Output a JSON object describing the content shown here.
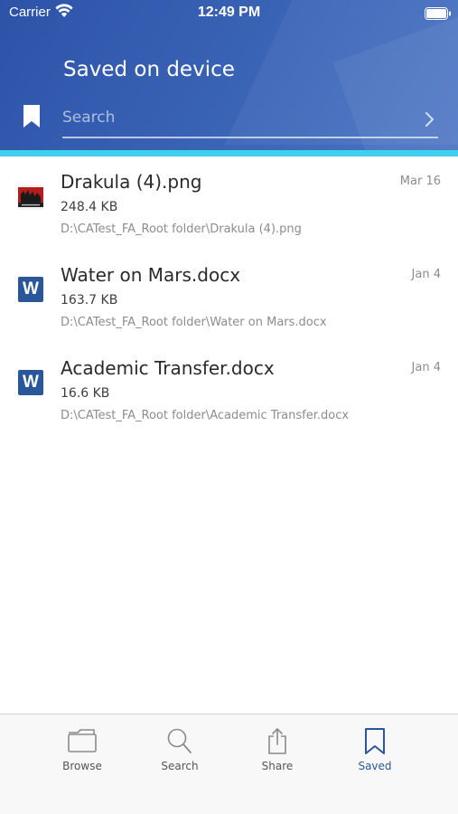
{
  "status_bar": {
    "carrier": "Carrier",
    "time": "12:49 PM"
  },
  "header": {
    "title": "Saved on device",
    "search_placeholder": "Search"
  },
  "files": [
    {
      "name": "Drakula (4).png",
      "size": "248.4 KB",
      "path": "D:\\CATest_FA_Root folder\\Drakula (4).png",
      "date": "Mar 16",
      "icon": "image-thumbnail-icon"
    },
    {
      "name": "Water on Mars.docx",
      "size": "163.7 KB",
      "path": "D:\\CATest_FA_Root folder\\Water on Mars.docx",
      "date": "Jan 4",
      "icon": "word-doc-icon",
      "icon_letter": "W"
    },
    {
      "name": "Academic Transfer.docx",
      "size": "16.6 KB",
      "path": "D:\\CATest_FA_Root folder\\Academic Transfer.docx",
      "date": "Jan 4",
      "icon": "word-doc-icon",
      "icon_letter": "W"
    }
  ],
  "tabs": [
    {
      "label": "Browse",
      "icon": "folder-icon",
      "active": false
    },
    {
      "label": "Search",
      "icon": "magnifier-icon",
      "active": false
    },
    {
      "label": "Share",
      "icon": "share-icon",
      "active": false
    },
    {
      "label": "Saved",
      "icon": "bookmark-icon",
      "active": true
    }
  ],
  "colors": {
    "header": "#3a64b6",
    "accent_bar": "#3fd0ee",
    "active_tab": "#2b579a",
    "inactive_tab": "#8a8a8a",
    "word_icon": "#2b579a"
  }
}
